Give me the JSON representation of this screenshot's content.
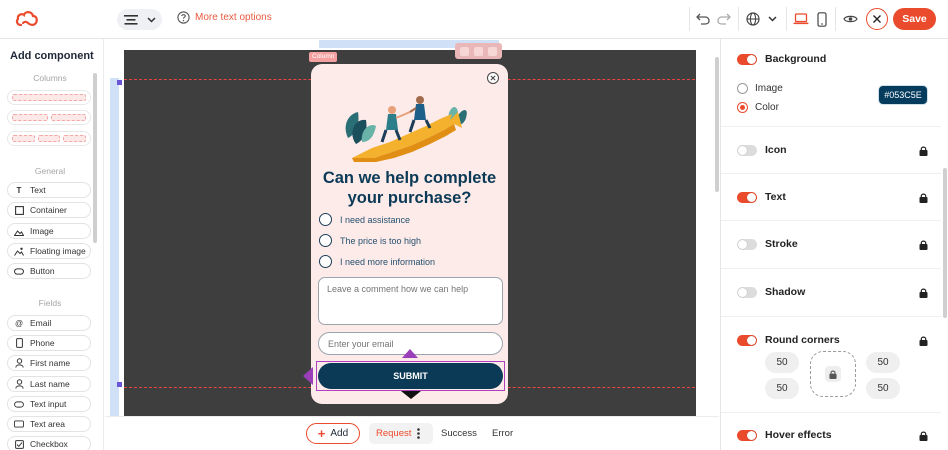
{
  "toolbar": {
    "more_text_options": "More text options",
    "save_label": "Save"
  },
  "left_panel": {
    "title": "Add component",
    "sections": {
      "columns": "Columns",
      "general": "General",
      "fields": "Fields"
    },
    "general_items": [
      {
        "label": "Text",
        "icon": "text-T-icon"
      },
      {
        "label": "Container",
        "icon": "square-icon"
      },
      {
        "label": "Image",
        "icon": "image-icon"
      },
      {
        "label": "Floating image",
        "icon": "floating-image-icon"
      },
      {
        "label": "Button",
        "icon": "button-pill-icon"
      }
    ],
    "field_items": [
      {
        "label": "Email",
        "icon": "at-icon"
      },
      {
        "label": "Phone",
        "icon": "phone-icon"
      },
      {
        "label": "First name",
        "icon": "user-icon"
      },
      {
        "label": "Last name",
        "icon": "user-icon"
      },
      {
        "label": "Text input",
        "icon": "input-icon"
      },
      {
        "label": "Text area",
        "icon": "textarea-icon"
      },
      {
        "label": "Checkbox",
        "icon": "checkbox-icon"
      }
    ]
  },
  "canvas": {
    "column_tag": "Column",
    "popup": {
      "title": "Can we help complete your purchase?",
      "options": [
        "I need assistance",
        "The price is too high",
        "I need more information"
      ],
      "comment_placeholder": "Leave a comment how we can help",
      "email_placeholder": "Enter your email",
      "submit_label": "SUBMIT"
    }
  },
  "bottom_bar": {
    "add_label": "Add",
    "tabs": [
      "Request",
      "Success",
      "Error"
    ]
  },
  "right_panel": {
    "background": {
      "label": "Background",
      "enabled": true
    },
    "background_type": {
      "image_label": "Image",
      "color_label": "Color",
      "selected": "Color",
      "color_value": "#053C5E"
    },
    "icon": {
      "label": "Icon",
      "enabled": false
    },
    "text": {
      "label": "Text",
      "enabled": true
    },
    "stroke": {
      "label": "Stroke",
      "enabled": false
    },
    "shadow": {
      "label": "Shadow",
      "enabled": false
    },
    "round_corners": {
      "label": "Round corners",
      "enabled": true,
      "values": [
        "50",
        "50",
        "50",
        "50"
      ]
    },
    "hover_effects": {
      "label": "Hover effects",
      "enabled": true
    }
  },
  "colors": {
    "accent": "#ea4b2c",
    "popup_bg": "#fdebe9",
    "navy": "#0b3a57",
    "canvas_dark": "#3e3e3e"
  }
}
